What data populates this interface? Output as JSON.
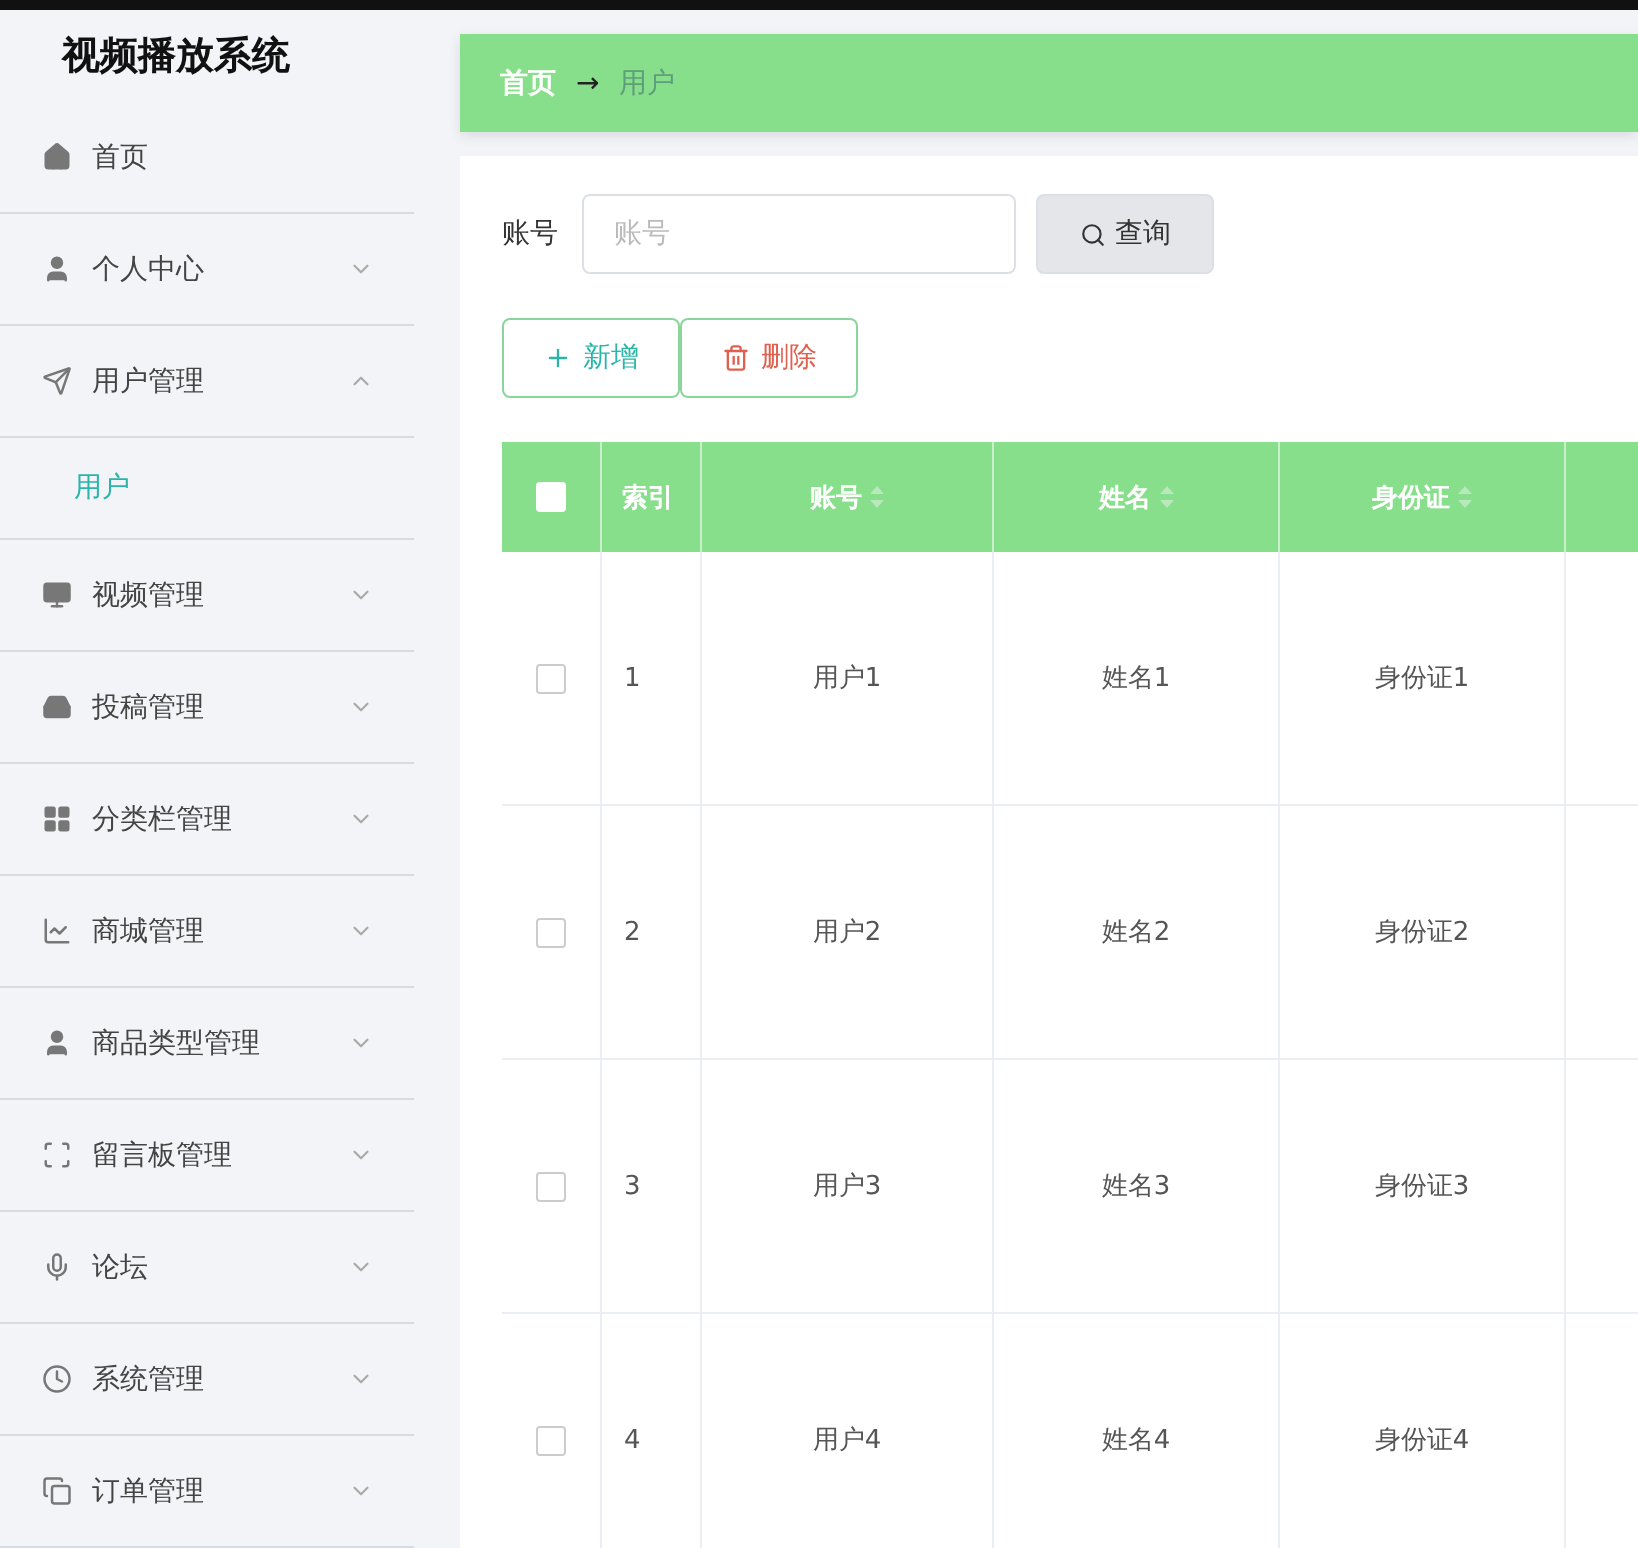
{
  "app_title": "视频播放系统",
  "sidebar": {
    "items": [
      {
        "label": "首页"
      },
      {
        "label": "个人中心",
        "expanded": false
      },
      {
        "label": "用户管理",
        "expanded": true,
        "children": [
          {
            "label": "用户",
            "selected": true
          }
        ]
      },
      {
        "label": "视频管理",
        "expanded": false
      },
      {
        "label": "投稿管理",
        "expanded": false
      },
      {
        "label": "分类栏管理",
        "expanded": false
      },
      {
        "label": "商城管理",
        "expanded": false
      },
      {
        "label": "商品类型管理",
        "expanded": false
      },
      {
        "label": "留言板管理",
        "expanded": false
      },
      {
        "label": "论坛",
        "expanded": false
      },
      {
        "label": "系统管理",
        "expanded": false
      },
      {
        "label": "订单管理",
        "expanded": false
      }
    ]
  },
  "breadcrumb": {
    "home": "首页",
    "separator": "→",
    "current": "用户"
  },
  "search": {
    "label": "账号",
    "placeholder": "账号",
    "button": "查询"
  },
  "actions": [
    {
      "kind": "add",
      "label": "新增"
    },
    {
      "kind": "delete",
      "label": "删除"
    }
  ],
  "table": {
    "select_all_checked": false,
    "columns": [
      {
        "label": "索引",
        "sortable": false
      },
      {
        "label": "账号",
        "sortable": true
      },
      {
        "label": "姓名",
        "sortable": true
      },
      {
        "label": "身份证",
        "sortable": true
      }
    ],
    "rows": [
      {
        "checked": false,
        "cells": [
          "1",
          "用户1",
          "姓名1",
          "身份证1"
        ]
      },
      {
        "checked": false,
        "cells": [
          "2",
          "用户2",
          "姓名2",
          "身份证2"
        ]
      },
      {
        "checked": false,
        "cells": [
          "3",
          "用户3",
          "姓名3",
          "身份证3"
        ]
      },
      {
        "checked": false,
        "cells": [
          "4",
          "用户4",
          "姓名4",
          "身份证4"
        ]
      }
    ]
  }
}
